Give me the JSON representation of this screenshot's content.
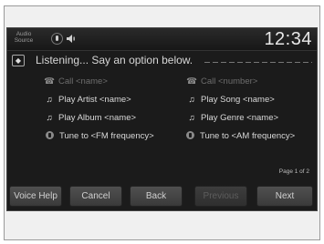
{
  "statusbar": {
    "audio_source_line1": "Audio",
    "audio_source_line2": "Source",
    "clock": "12:34"
  },
  "prompt": {
    "text": "Listening... Say an option below."
  },
  "commands": [
    {
      "icon": "phone-icon",
      "label": "Call <name>",
      "enabled": false
    },
    {
      "icon": "phone-icon",
      "label": "Call <number>",
      "enabled": false
    },
    {
      "icon": "music-note-icon",
      "label": "Play Artist <name>",
      "enabled": true
    },
    {
      "icon": "music-note-icon",
      "label": "Play Song <name>",
      "enabled": true
    },
    {
      "icon": "music-note-icon",
      "label": "Play Album <name>",
      "enabled": true
    },
    {
      "icon": "music-note-icon",
      "label": "Play Genre <name>",
      "enabled": true
    },
    {
      "icon": "radio-icon",
      "label": "Tune to <FM frequency>",
      "enabled": true
    },
    {
      "icon": "radio-icon",
      "label": "Tune to <AM frequency>",
      "enabled": true
    }
  ],
  "page_indicator": "Page 1 of 2",
  "buttons": {
    "voice_help": "Voice Help",
    "cancel": "Cancel",
    "back": "Back",
    "previous": "Previous",
    "next": "Next"
  }
}
